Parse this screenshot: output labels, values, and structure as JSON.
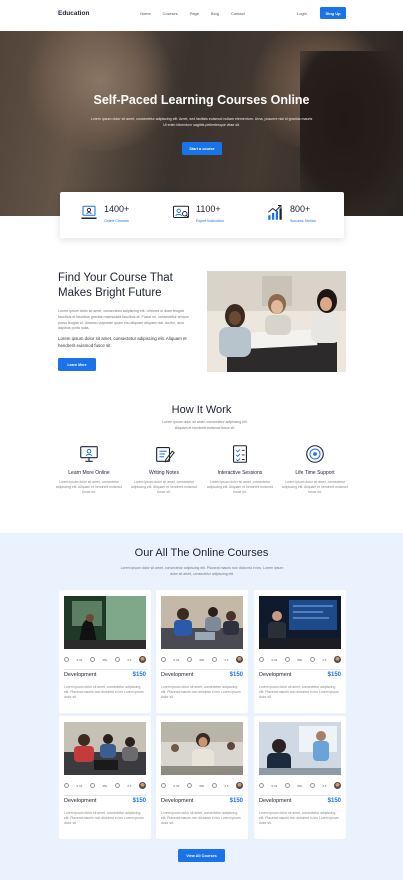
{
  "header": {
    "logo": "Education",
    "nav": [
      "Home",
      "Courses",
      "Page",
      "Blog",
      "Contact"
    ],
    "login": "Login",
    "signup": "Sing Up"
  },
  "hero": {
    "title": "Self-Paced Learning Courses Online",
    "subtitle": "Lorem ipsum dolor sit amet, consectetur adipiscing elit. Amet, sed facilisis euismod nullam elementum. Urna, posuere nisl id gravida mauris Ut enim bibendum sagittis pellentesque vitae sit.",
    "button": "Start a course"
  },
  "stats": [
    {
      "number": "1400+",
      "label": "Online Courses",
      "icon": "online-course-icon"
    },
    {
      "number": "1100+",
      "label": "Expert Instruction",
      "icon": "instructor-icon"
    },
    {
      "number": "800+",
      "label": "Success Stories",
      "icon": "growth-chart-icon"
    }
  ],
  "find": {
    "title": "Find Your Course That Makes Bright Future",
    "p1": "Lorem ipsum dolor sit amet, consectetur adipiscing elit. Ultricies ut diam feugiat faucibus et faucibus gravida malesuada faucibus at. Fusce mi, consectetur tempor purus feugiat id. Ullamco vulputate quam nisi aliquam aliquam nisl. Auctor, arcu dapibus porta nulla.",
    "p2": "Lorem ipsum dolor sit amet, consectetur adipiscing elit. Aliquam et hendrerit euismod fusce sit.",
    "button": "Learn More"
  },
  "how": {
    "title": "How It Work",
    "subtitle": "Lorem ipsum dolor sit amet, consectetur adipiscing elit. Aliquam et hendrerit euismod fusce sit.",
    "steps": [
      {
        "title": "Learn More Online",
        "desc": "Lorem ipsum dolor sit amet, consectetur adipiscing elit. Aliquam et hendrerit euismod fusce sit.",
        "icon": "monitor-icon"
      },
      {
        "title": "Writing Notes",
        "desc": "Lorem ipsum dolor sit amet, consectetur adipiscing elit. Aliquam et hendrerit euismod fusce sit.",
        "icon": "pencil-icon"
      },
      {
        "title": "Interactive Sessions",
        "desc": "Lorem ipsum dolor sit amet, consectetur adipiscing elit. Aliquam et hendrerit euismod fusce sit.",
        "icon": "checklist-icon"
      },
      {
        "title": "Life Time Support",
        "desc": "Lorem ipsum dolor sit amet, consectetur adipiscing elit. Aliquam et hendrerit euismod fusce sit.",
        "icon": "support-target-icon"
      }
    ]
  },
  "courses": {
    "title": "Our All The Online Courses",
    "subtitle": "Lorem ipsum dolor sit amet, consectetur adipiscing elit. Placerat mauris non dictumst in leo. Lorem ipsum dolor sit amet, consectetur adipiscing elit.",
    "meta": {
      "lessons": "5.0k",
      "level": "95k",
      "rating": "4.5"
    },
    "items": [
      {
        "title": "Development",
        "price": "$150",
        "desc": "Lorem ipsum dolor sit amet, consectetur adipiscing elit. Placerat mauris non dictumst in leo Lorem ipsum dolor sit."
      },
      {
        "title": "Development",
        "price": "$150",
        "desc": "Lorem ipsum dolor sit amet, consectetur adipiscing elit. Placerat mauris non dictumst in leo Lorem ipsum dolor sit."
      },
      {
        "title": "Development",
        "price": "$150",
        "desc": "Lorem ipsum dolor sit amet, consectetur adipiscing elit. Placerat mauris non dictumst in leo Lorem ipsum dolor sit."
      },
      {
        "title": "Development",
        "price": "$150",
        "desc": "Lorem ipsum dolor sit amet, consectetur adipiscing elit. Placerat mauris non dictumst in leo Lorem ipsum dolor sit."
      },
      {
        "title": "Development",
        "price": "$150",
        "desc": "Lorem ipsum dolor sit amet, consectetur adipiscing elit. Placerat mauris non dictumst in leo Lorem ipsum dolor sit."
      },
      {
        "title": "Development",
        "price": "$150",
        "desc": "Lorem ipsum dolor sit amet, consectetur adipiscing elit. Placerat mauris non dictumst in leo Lorem ipsum dolor sit."
      }
    ],
    "button": "View All Courses"
  },
  "colors": {
    "accent": "#1a73e8",
    "section_bg": "#eaf2fe"
  }
}
